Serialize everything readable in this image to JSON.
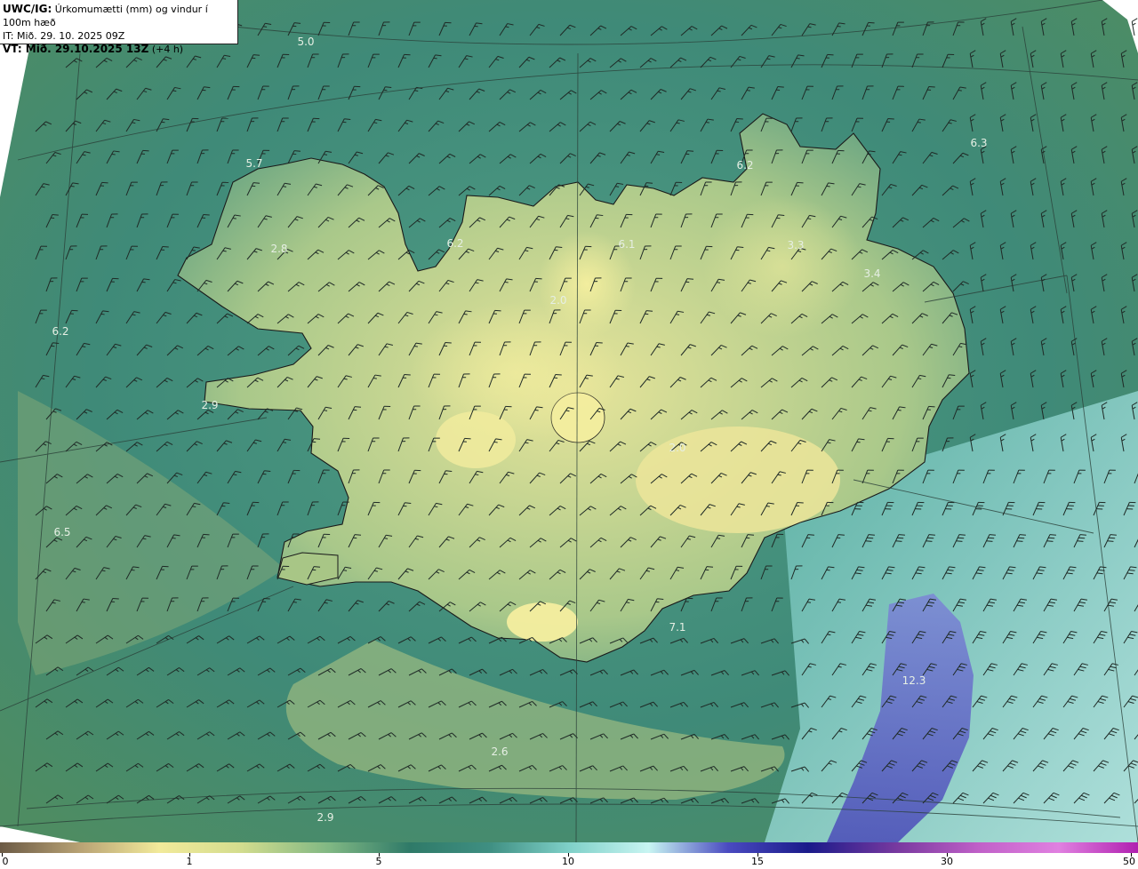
{
  "header": {
    "product": "UWC/IG:",
    "parameter": "Úrkomumætti (mm) og vindur í 100m hæð",
    "init_time": "IT: Mið. 29. 10. 2025 09Z",
    "valid_prefix": "VT: Mið. 29.10.2025 13Z",
    "valid_suffix": "(+4 h)"
  },
  "map_labels": [
    "5.0",
    "6.3",
    "6.2",
    "5.7",
    "2.8",
    "6.2",
    "6.1",
    "3.3",
    "3.4",
    "2.0",
    "6.2",
    "2.9",
    "2.0",
    "6.5",
    "7.1",
    "12.3",
    "2.6",
    "2.9"
  ],
  "colorbar": {
    "ticks": [
      "0",
      "1",
      "5",
      "10",
      "15",
      "30",
      "50"
    ],
    "colors": [
      "#6b5a45",
      "#b8a274",
      "#f2ea9a",
      "#d4dd8e",
      "#7fb783",
      "#2f7a68",
      "#3f8f82",
      "#7fd0c8",
      "#c8f5f2",
      "#4a4ac0",
      "#1a1a8a",
      "#7a3aa0",
      "#c060c8",
      "#e080e0",
      "#b020b0"
    ]
  },
  "legend_colors": {
    "ocean": "#3f8a7a",
    "land_low": "#cfd98c",
    "land_high": "#f1eaa0",
    "heavy_rain": "#5a62c8",
    "coast_line": "#1a1a1a"
  }
}
